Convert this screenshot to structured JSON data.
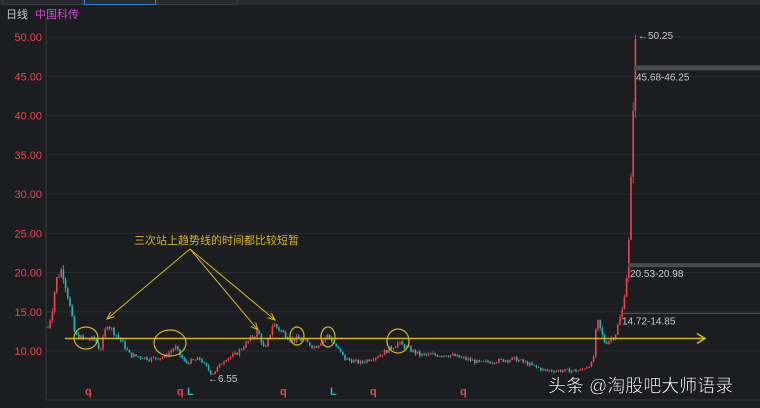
{
  "header": {
    "period": "日线",
    "stock_name": "中国科传"
  },
  "watermark": "头条 @淘股吧大师语录",
  "colors": {
    "up": "#e8474f",
    "down": "#2bb5b8",
    "axis": "#e8474f",
    "annotation": "#d4b52a",
    "bg": "#1c1d21",
    "name": "#d34bd6"
  },
  "chart_data": {
    "type": "candlestick",
    "title": "中国科传 日线",
    "ylim": [
      5,
      51
    ],
    "yticks": [
      "10.00",
      "15.00",
      "20.00",
      "25.00",
      "30.00",
      "35.00",
      "40.00",
      "45.00",
      "50.00"
    ],
    "ytick_values": [
      10,
      15,
      20,
      25,
      30,
      35,
      40,
      45,
      50
    ],
    "close_keypoints": [
      13,
      15,
      19,
      20.5,
      17,
      12,
      11.5,
      11.5,
      10,
      13.5,
      11.5,
      9.5,
      9,
      9.3,
      10.5,
      8.5,
      9,
      7,
      9,
      9.5,
      12.5,
      10,
      13.5,
      11.5,
      11.5,
      10.5,
      12,
      9,
      8.5,
      9.5,
      11,
      9.5,
      9.5,
      8.5,
      9,
      7.5,
      7.5,
      8.5,
      14,
      11,
      12,
      15,
      21,
      35,
      46,
      50
    ],
    "price_labels": [
      {
        "text": "50.25",
        "value": 50.25
      },
      {
        "text": "6.55",
        "value": 6.55
      }
    ],
    "levels": [
      {
        "text": "45.68-46.25",
        "value": 46
      },
      {
        "text": "20.53-20.98",
        "value": 20.8
      },
      {
        "text": "14.72-14.85",
        "value": 14.8
      }
    ],
    "trendline_value": 11.6,
    "annotation": "三次站上趋势线的时间都比较短暂",
    "markers": [
      {
        "text": "q",
        "color": "up"
      },
      {
        "text": "q",
        "color": "up"
      },
      {
        "text": "L",
        "color": "down"
      },
      {
        "text": "q",
        "color": "up"
      },
      {
        "text": "L",
        "color": "down"
      },
      {
        "text": "q",
        "color": "up"
      },
      {
        "text": "q",
        "color": "up"
      }
    ]
  }
}
